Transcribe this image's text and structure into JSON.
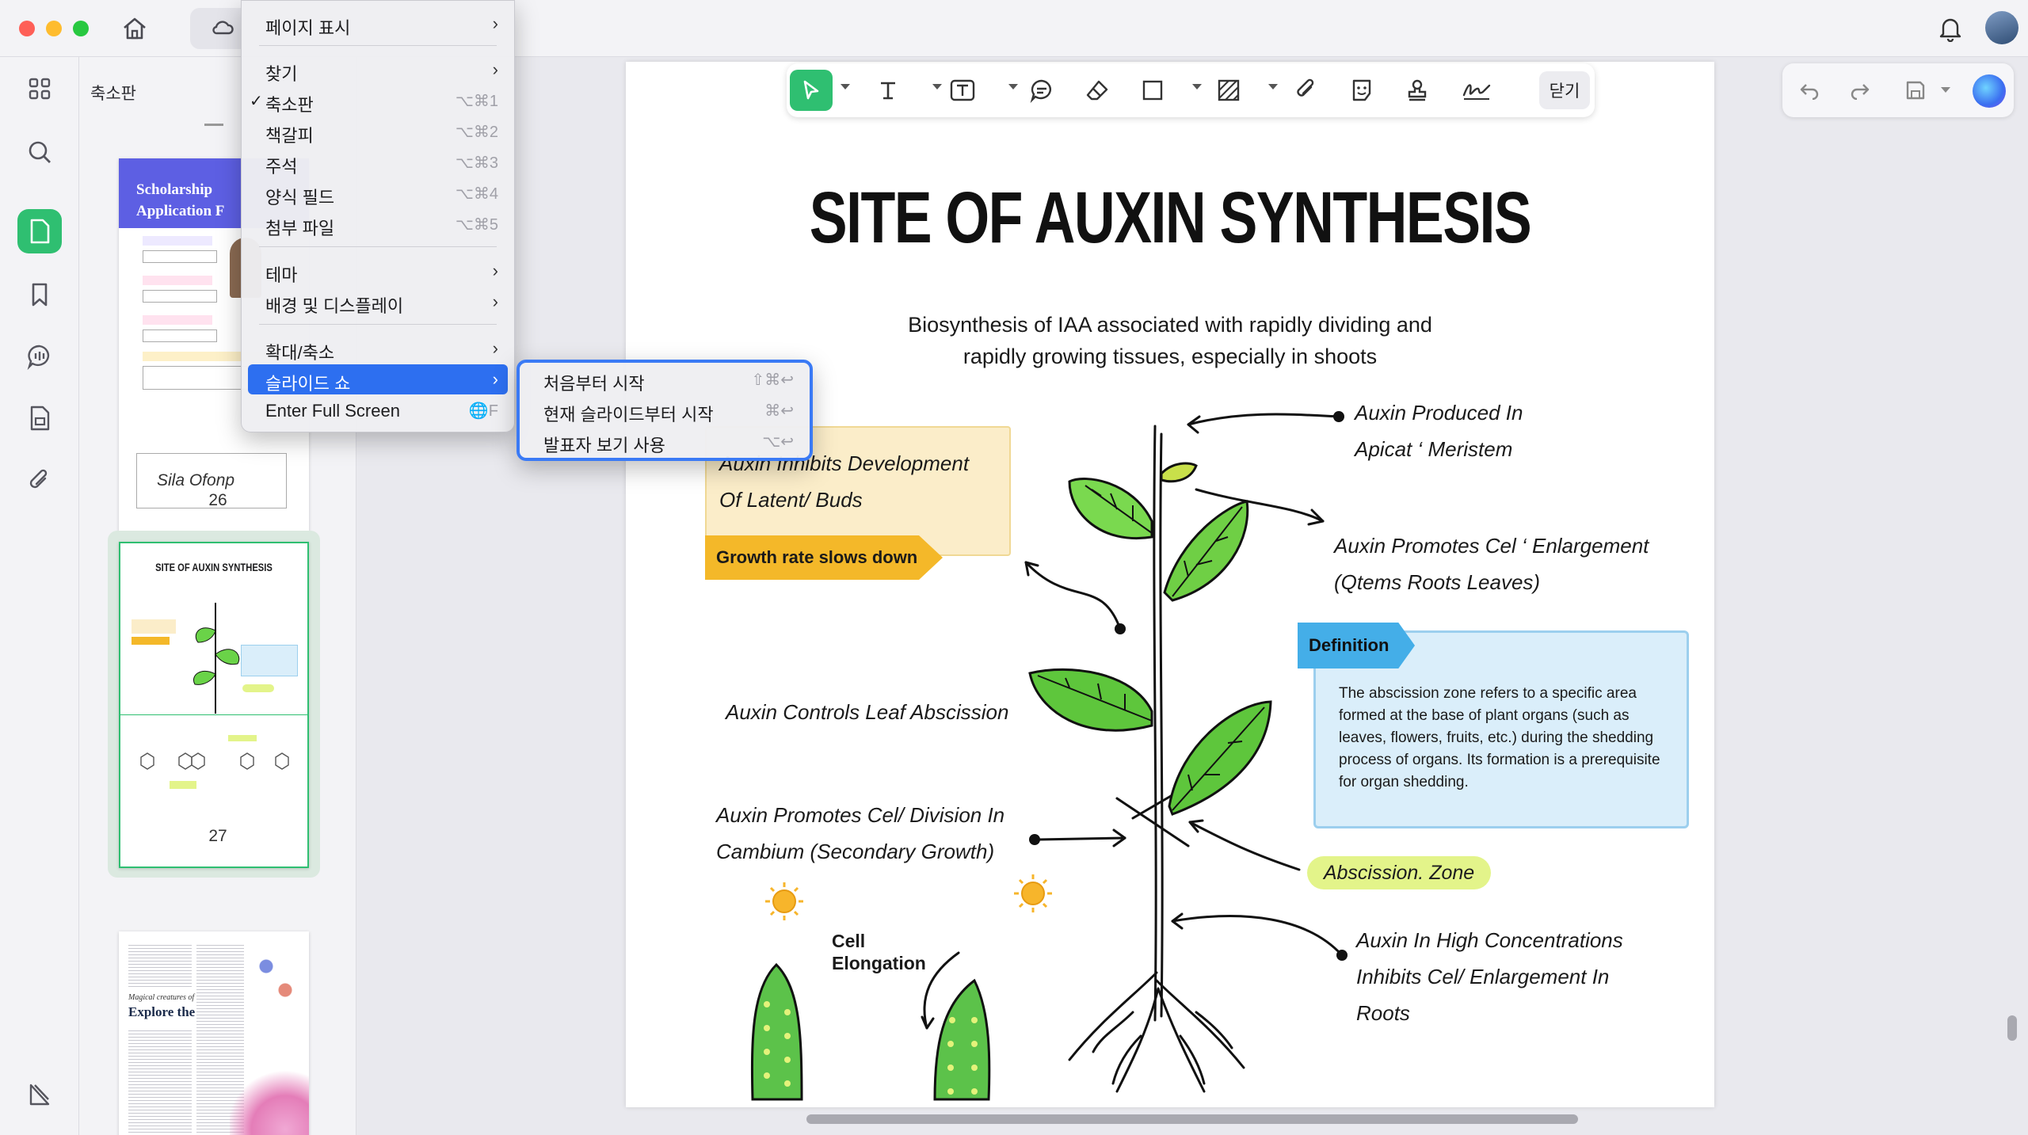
{
  "sidebar": {
    "title": "축소판",
    "thumbnails": [
      {
        "page": "26",
        "title_line1": "Scholarship",
        "title_line2": "Application F",
        "signature": "Sila Ofonp"
      },
      {
        "page": "27",
        "title": "SITE OF AUXIN SYNTHESIS"
      },
      {
        "subtitle": "Magical creatures of the sea.",
        "title": "Explore the Pacific"
      }
    ]
  },
  "toolbar": {
    "close_label": "닫기"
  },
  "view_menu": {
    "items": [
      {
        "label": "페이지 표시",
        "submenu": true
      },
      {
        "label": "찾기",
        "submenu": true
      },
      {
        "label": "축소판",
        "shortcut": "⌥⌘1",
        "checked": true
      },
      {
        "label": "책갈피",
        "shortcut": "⌥⌘2"
      },
      {
        "label": "주석",
        "shortcut": "⌥⌘3"
      },
      {
        "label": "양식 필드",
        "shortcut": "⌥⌘4"
      },
      {
        "label": "첨부 파일",
        "shortcut": "⌥⌘5"
      },
      {
        "label": "테마",
        "submenu": true
      },
      {
        "label": "배경 및 디스플레이",
        "submenu": true
      },
      {
        "label": "확대/축소",
        "submenu": true
      },
      {
        "label": "슬라이드 쇼",
        "submenu": true,
        "highlighted": true
      },
      {
        "label": "Enter Full Screen",
        "shortcut": "🌐F"
      }
    ]
  },
  "slideshow_menu": {
    "items": [
      {
        "label": "처음부터 시작",
        "shortcut": "⇧⌘↩"
      },
      {
        "label": "현재 슬라이드부터 시작",
        "shortcut": "⌘↩"
      },
      {
        "label": "발표자 보기 사용",
        "shortcut": "⌥↩"
      }
    ]
  },
  "page": {
    "title": "SITE OF AUXIN SYNTHESIS",
    "subtitle_line1": "Biosynthesis of IAA associated with rapidly dividing and",
    "subtitle_line2": "rapidly growing tissues, especially in shoots",
    "inhibits_line1": "Auxin Inhibits Development",
    "inhibits_line2": "Of Latent/ Buds",
    "growth_tag": "Growth rate slows down",
    "produced_line1": "Auxin Produced In",
    "produced_line2": "Apicat ‘ Meristem",
    "promotes_line1": "Auxin Promotes Cel ‘ Enlargement",
    "promotes_line2": "(Qtems Roots Leaves)",
    "definition_tag": "Definition",
    "definition_text": "The abscission zone refers to a specific area formed at the base of plant organs (such as leaves, flowers, fruits, etc.) during the shedding process of organs. Its formation is a prerequisite for organ shedding.",
    "leaf_abscission": "Auxin Controls Leaf Abscission",
    "division_line1": "Auxin Promotes Cel/ Division In",
    "division_line2": "Cambium (Secondary Growth)",
    "abscission_zone": "Abscission. Zone",
    "high_line1": "Auxin In High Concentrations",
    "high_line2": "Inhibits Cel/ Enlargement In",
    "high_line3": "Roots",
    "cell_line1": "Cell",
    "cell_line2": "Elongation"
  },
  "colors": {
    "accent_green": "#2fbf71",
    "menu_highlight": "#2d6ff0",
    "orange_tag": "#f4b829",
    "definition_blue": "#44aee8"
  }
}
